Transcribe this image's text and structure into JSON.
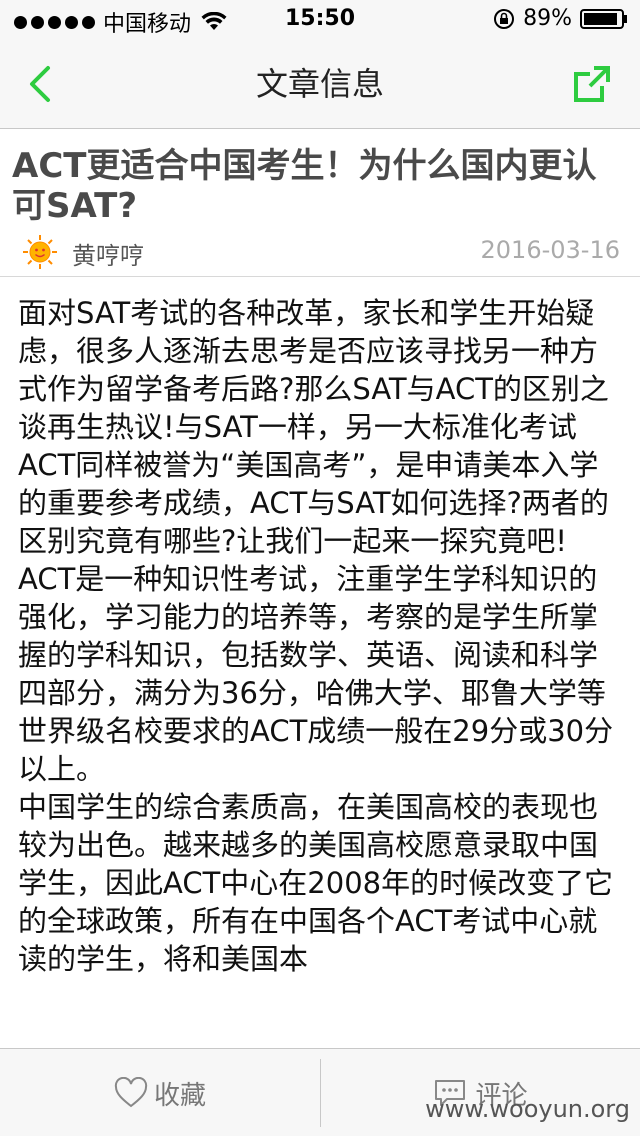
{
  "status_bar": {
    "carrier": "中国移动",
    "time": "15:50",
    "battery": "89%"
  },
  "nav": {
    "title": "文章信息",
    "accent_color": "#2ecc40"
  },
  "article": {
    "title": "ACT更适合中国考生！为什么国内更认可SAT?",
    "author": "黄哼哼",
    "date": "2016-03-16",
    "paragraphs": [
      "面对SAT考试的各种改革，家长和学生开始疑虑，很多人逐渐去思考是否应该寻找另一种方式作为留学备考后路?那么SAT与ACT的区别之谈再生热议!与SAT一样，另一大标准化考试ACT同样被誉为“美国高考”，是申请美本入学的重要参考成绩，ACT与SAT如何选择?两者的区别究竟有哪些?让我们一起来一探究竟吧!",
      "ACT是一种知识性考试，注重学生学科知识的强化，学习能力的培养等，考察的是学生所掌握的学科知识，包括数学、英语、阅读和科学四部分，满分为36分，哈佛大学、耶鲁大学等世界级名校要求的ACT成绩一般在29分或30分以上。",
      "中国学生的综合素质高，在美国高校的表现也较为出色。越来越多的美国高校愿意录取中国学生，因此ACT中心在2008年的时候改变了它的全球政策，所有在中国各个ACT考试中心就读的学生，将和美国本"
    ]
  },
  "toolbar": {
    "favorite_label": "收藏",
    "comment_label": "评论"
  },
  "watermark": "www.wooyun.org"
}
